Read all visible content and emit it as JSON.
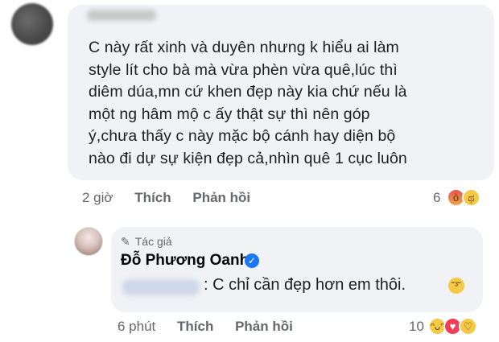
{
  "comment1": {
    "text_lines": [
      "C này rất xinh và duyên nhưng k hiểu ai làm",
      "style lít cho bà mà vừa phèn vừa quê,lúc thì",
      "diêm dúa,mn cứ khen đẹp này kia chứ nếu là",
      "một ng hâm mộ c ấy thật sự thì nên góp",
      "ý,chưa thấy c này mặc bộ cánh hay diện bộ",
      "nào đi dự sự kiện đẹp cả,nhìn quê 1 cục luôn"
    ],
    "time": "2 giờ",
    "like_label": "Thích",
    "reply_label": "Phản hồi",
    "reaction_count": "6",
    "reaction_icons": [
      "angry-reaction-icon",
      "sad-reaction-icon"
    ]
  },
  "comment2": {
    "author_tag": "Tác giả",
    "author_name": "Đỗ Phương Oanh",
    "text": ": C chỉ cần đẹp hơn em thôi.",
    "time": "6 phút",
    "like_label": "Thích",
    "reply_label": "Phản hồi",
    "reaction_count": "10",
    "reaction_icons": [
      "haha-reaction-icon",
      "love-reaction-icon",
      "care-reaction-icon"
    ]
  },
  "colors": {
    "bubble": "#f0f2f5",
    "meta_text": "#65676b",
    "verified": "#1877f2"
  }
}
